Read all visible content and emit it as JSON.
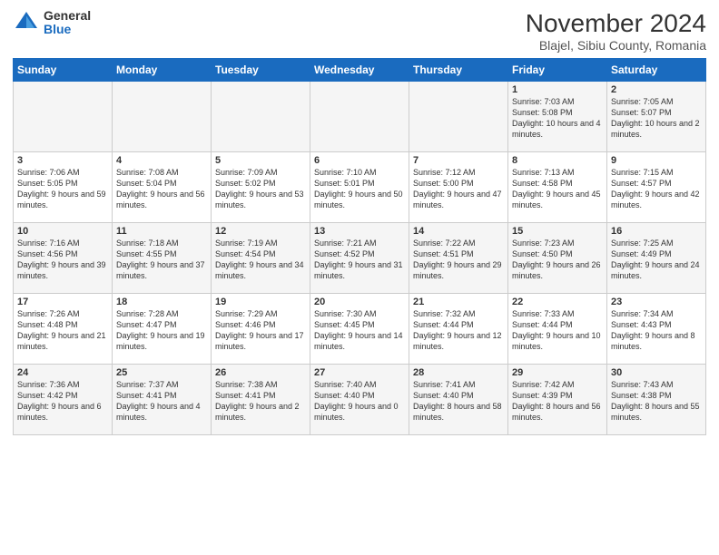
{
  "header": {
    "logo_general": "General",
    "logo_blue": "Blue",
    "month_title": "November 2024",
    "subtitle": "Blajel, Sibiu County, Romania"
  },
  "days_of_week": [
    "Sunday",
    "Monday",
    "Tuesday",
    "Wednesday",
    "Thursday",
    "Friday",
    "Saturday"
  ],
  "weeks": [
    [
      {
        "day": "",
        "info": ""
      },
      {
        "day": "",
        "info": ""
      },
      {
        "day": "",
        "info": ""
      },
      {
        "day": "",
        "info": ""
      },
      {
        "day": "",
        "info": ""
      },
      {
        "day": "1",
        "info": "Sunrise: 7:03 AM\nSunset: 5:08 PM\nDaylight: 10 hours and 4 minutes."
      },
      {
        "day": "2",
        "info": "Sunrise: 7:05 AM\nSunset: 5:07 PM\nDaylight: 10 hours and 2 minutes."
      }
    ],
    [
      {
        "day": "3",
        "info": "Sunrise: 7:06 AM\nSunset: 5:05 PM\nDaylight: 9 hours and 59 minutes."
      },
      {
        "day": "4",
        "info": "Sunrise: 7:08 AM\nSunset: 5:04 PM\nDaylight: 9 hours and 56 minutes."
      },
      {
        "day": "5",
        "info": "Sunrise: 7:09 AM\nSunset: 5:02 PM\nDaylight: 9 hours and 53 minutes."
      },
      {
        "day": "6",
        "info": "Sunrise: 7:10 AM\nSunset: 5:01 PM\nDaylight: 9 hours and 50 minutes."
      },
      {
        "day": "7",
        "info": "Sunrise: 7:12 AM\nSunset: 5:00 PM\nDaylight: 9 hours and 47 minutes."
      },
      {
        "day": "8",
        "info": "Sunrise: 7:13 AM\nSunset: 4:58 PM\nDaylight: 9 hours and 45 minutes."
      },
      {
        "day": "9",
        "info": "Sunrise: 7:15 AM\nSunset: 4:57 PM\nDaylight: 9 hours and 42 minutes."
      }
    ],
    [
      {
        "day": "10",
        "info": "Sunrise: 7:16 AM\nSunset: 4:56 PM\nDaylight: 9 hours and 39 minutes."
      },
      {
        "day": "11",
        "info": "Sunrise: 7:18 AM\nSunset: 4:55 PM\nDaylight: 9 hours and 37 minutes."
      },
      {
        "day": "12",
        "info": "Sunrise: 7:19 AM\nSunset: 4:54 PM\nDaylight: 9 hours and 34 minutes."
      },
      {
        "day": "13",
        "info": "Sunrise: 7:21 AM\nSunset: 4:52 PM\nDaylight: 9 hours and 31 minutes."
      },
      {
        "day": "14",
        "info": "Sunrise: 7:22 AM\nSunset: 4:51 PM\nDaylight: 9 hours and 29 minutes."
      },
      {
        "day": "15",
        "info": "Sunrise: 7:23 AM\nSunset: 4:50 PM\nDaylight: 9 hours and 26 minutes."
      },
      {
        "day": "16",
        "info": "Sunrise: 7:25 AM\nSunset: 4:49 PM\nDaylight: 9 hours and 24 minutes."
      }
    ],
    [
      {
        "day": "17",
        "info": "Sunrise: 7:26 AM\nSunset: 4:48 PM\nDaylight: 9 hours and 21 minutes."
      },
      {
        "day": "18",
        "info": "Sunrise: 7:28 AM\nSunset: 4:47 PM\nDaylight: 9 hours and 19 minutes."
      },
      {
        "day": "19",
        "info": "Sunrise: 7:29 AM\nSunset: 4:46 PM\nDaylight: 9 hours and 17 minutes."
      },
      {
        "day": "20",
        "info": "Sunrise: 7:30 AM\nSunset: 4:45 PM\nDaylight: 9 hours and 14 minutes."
      },
      {
        "day": "21",
        "info": "Sunrise: 7:32 AM\nSunset: 4:44 PM\nDaylight: 9 hours and 12 minutes."
      },
      {
        "day": "22",
        "info": "Sunrise: 7:33 AM\nSunset: 4:44 PM\nDaylight: 9 hours and 10 minutes."
      },
      {
        "day": "23",
        "info": "Sunrise: 7:34 AM\nSunset: 4:43 PM\nDaylight: 9 hours and 8 minutes."
      }
    ],
    [
      {
        "day": "24",
        "info": "Sunrise: 7:36 AM\nSunset: 4:42 PM\nDaylight: 9 hours and 6 minutes."
      },
      {
        "day": "25",
        "info": "Sunrise: 7:37 AM\nSunset: 4:41 PM\nDaylight: 9 hours and 4 minutes."
      },
      {
        "day": "26",
        "info": "Sunrise: 7:38 AM\nSunset: 4:41 PM\nDaylight: 9 hours and 2 minutes."
      },
      {
        "day": "27",
        "info": "Sunrise: 7:40 AM\nSunset: 4:40 PM\nDaylight: 9 hours and 0 minutes."
      },
      {
        "day": "28",
        "info": "Sunrise: 7:41 AM\nSunset: 4:40 PM\nDaylight: 8 hours and 58 minutes."
      },
      {
        "day": "29",
        "info": "Sunrise: 7:42 AM\nSunset: 4:39 PM\nDaylight: 8 hours and 56 minutes."
      },
      {
        "day": "30",
        "info": "Sunrise: 7:43 AM\nSunset: 4:38 PM\nDaylight: 8 hours and 55 minutes."
      }
    ]
  ]
}
